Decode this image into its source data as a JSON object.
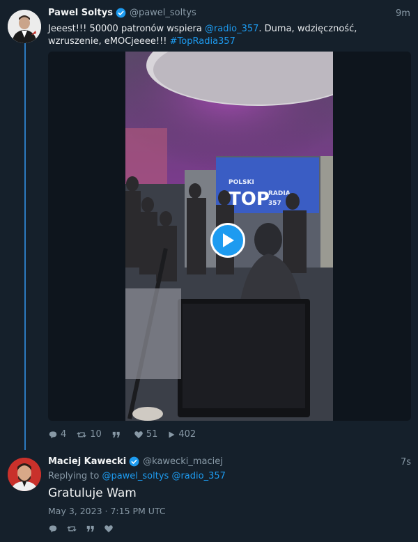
{
  "tweet": {
    "author_name": "Pawel Soltys",
    "author_handle": "@pawel_soltys",
    "time": "9m",
    "text_part1": "Jeeest!!! 50000 patronów wspiera ",
    "mention": "@radio_357",
    "text_part2": ". Duma, wdzięczność, wzruszenie, eMOCjeeee!!! ",
    "hashtag": "#TopRadia357",
    "video_sign_text1": "POLSKI",
    "video_sign_text2": "TOP",
    "video_sign_text3": "RADIA",
    "video_sign_text4": "357",
    "stats": {
      "replies": "4",
      "retweets": "10",
      "likes": "51",
      "views": "402"
    }
  },
  "reply": {
    "author_name": "Maciej Kawecki",
    "author_handle": "@kawecki_maciej",
    "time": "7s",
    "replying_label": "Replying to ",
    "replying_handle1": "@pawel_soltys",
    "replying_handle2": "@radio_357",
    "text": "Gratuluje Wam",
    "date": "May 3, 2023 · 7:15 PM UTC"
  },
  "colors": {
    "background": "#15202b",
    "link": "#1d9bf0",
    "muted": "#8899a6",
    "thread_line": "#2c7ac0"
  }
}
